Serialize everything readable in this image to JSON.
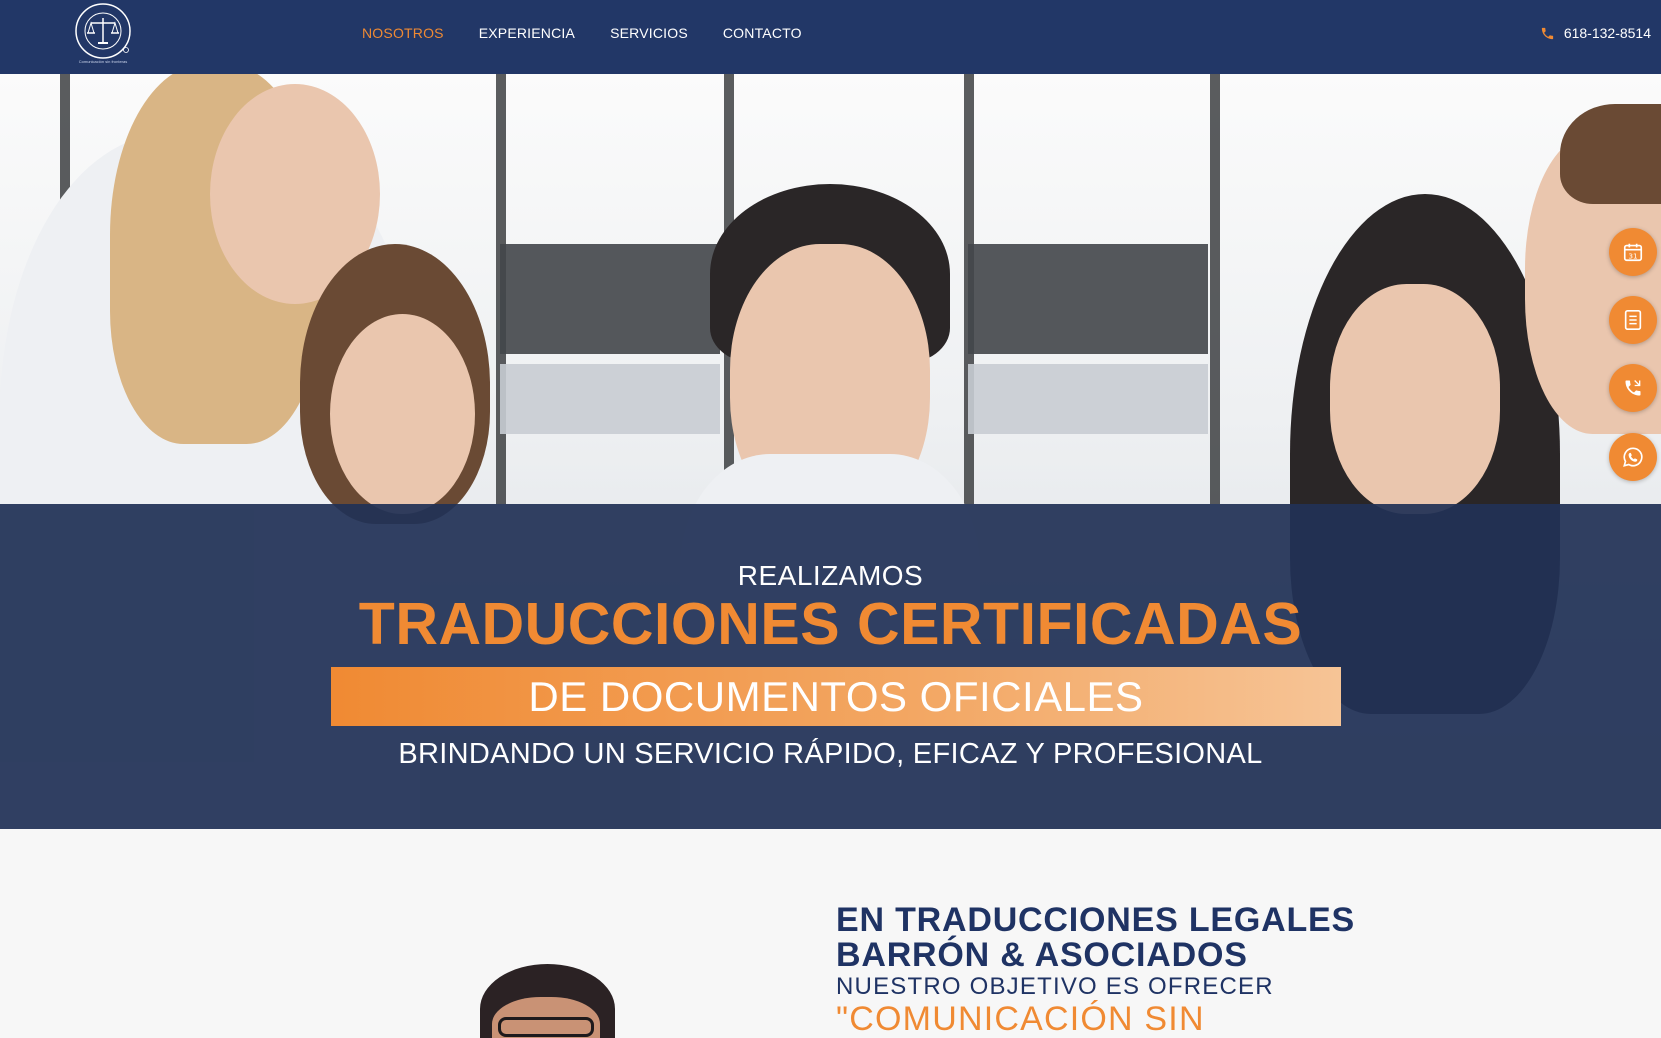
{
  "header": {
    "logo_caption": "Comunicación sin fronteras",
    "nav": [
      {
        "label": "NOSOTROS",
        "active": true
      },
      {
        "label": "EXPERIENCIA",
        "active": false
      },
      {
        "label": "SERVICIOS",
        "active": false
      },
      {
        "label": "CONTACTO",
        "active": false
      }
    ],
    "phone": "618-132-8514"
  },
  "hero": {
    "line1": "REALIZAMOS",
    "headline": "TRADUCCIONES CERTIFICADAS",
    "band": "DE DOCUMENTOS OFICIALES",
    "subline": "BRINDANDO UN SERVICIO RÁPIDO, EFICAZ Y PROFESIONAL"
  },
  "floating_actions": [
    {
      "icon": "calendar-icon",
      "calendar_day": "31"
    },
    {
      "icon": "document-icon"
    },
    {
      "icon": "phone-icon"
    },
    {
      "icon": "whatsapp-icon"
    }
  ],
  "about": {
    "title_line1": "EN TRADUCCIONES LEGALES",
    "title_line2": "BARRÓN & ASOCIADOS",
    "subtitle": "NUESTRO OBJETIVO ES OFRECER",
    "quote_start": "\"COMUNICACIÓN SIN"
  },
  "colors": {
    "navy": "#223767",
    "orange": "#f08a33",
    "white": "#ffffff"
  }
}
